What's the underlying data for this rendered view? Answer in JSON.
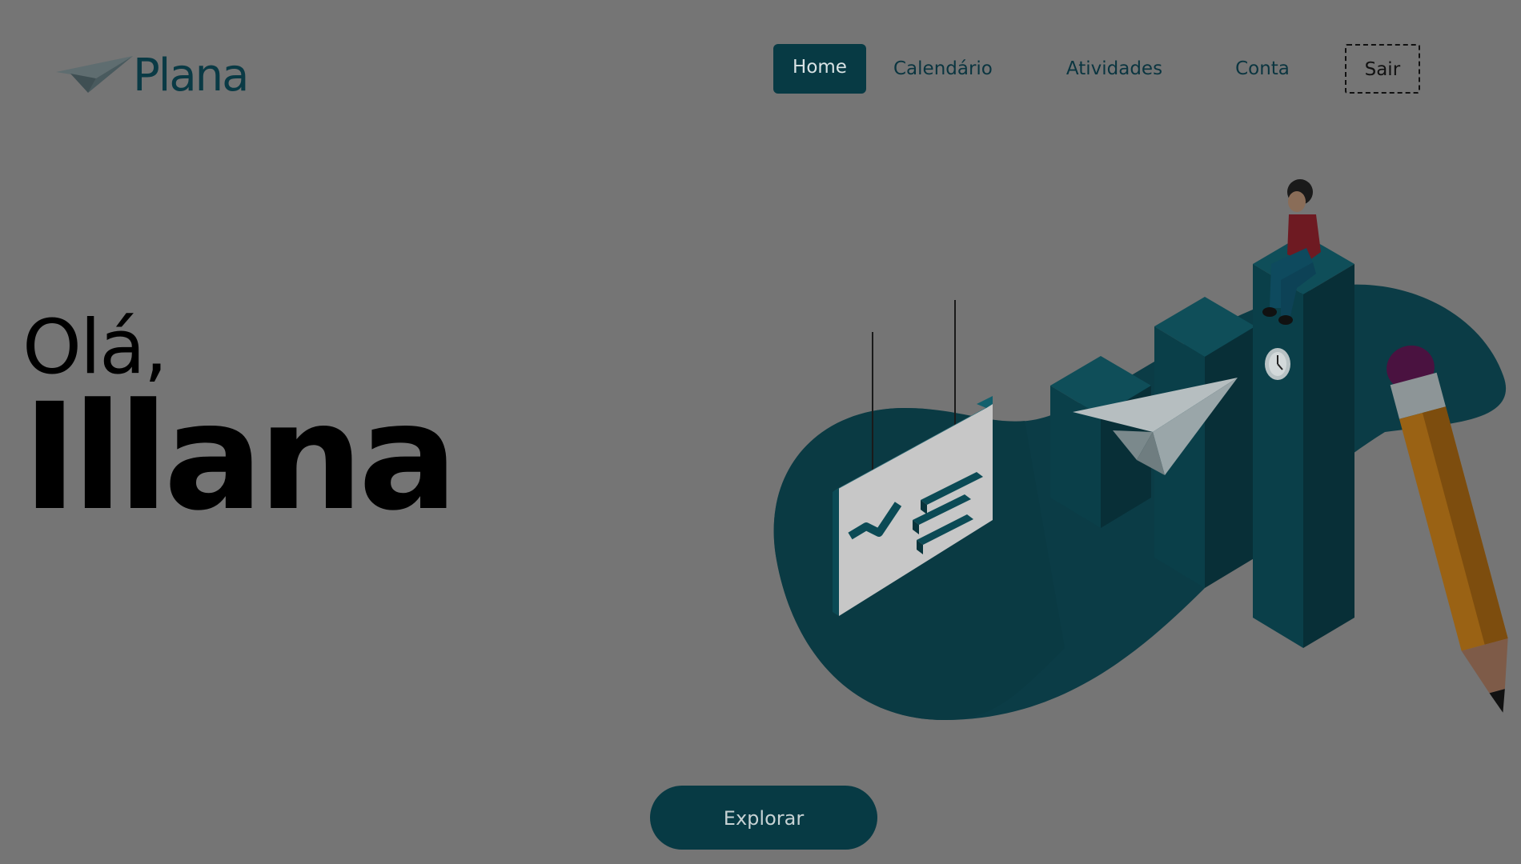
{
  "brand": {
    "name": "Plana",
    "icon": "paper-plane-icon"
  },
  "nav": {
    "items": [
      {
        "label": "Home",
        "active": true
      },
      {
        "label": "Calendário",
        "active": false
      },
      {
        "label": "Atividades",
        "active": false
      },
      {
        "label": "Conta",
        "active": false
      }
    ],
    "logout_label": "Sair"
  },
  "hero": {
    "greeting": "Olá,",
    "user_name": "Illana",
    "illustration": "isometric-productivity-illustration"
  },
  "cta": {
    "label": "Explorar"
  },
  "colors": {
    "background": "#757575",
    "primary": "#073a44",
    "accent_red": "#7a1a22",
    "pencil": "#a86a14"
  }
}
